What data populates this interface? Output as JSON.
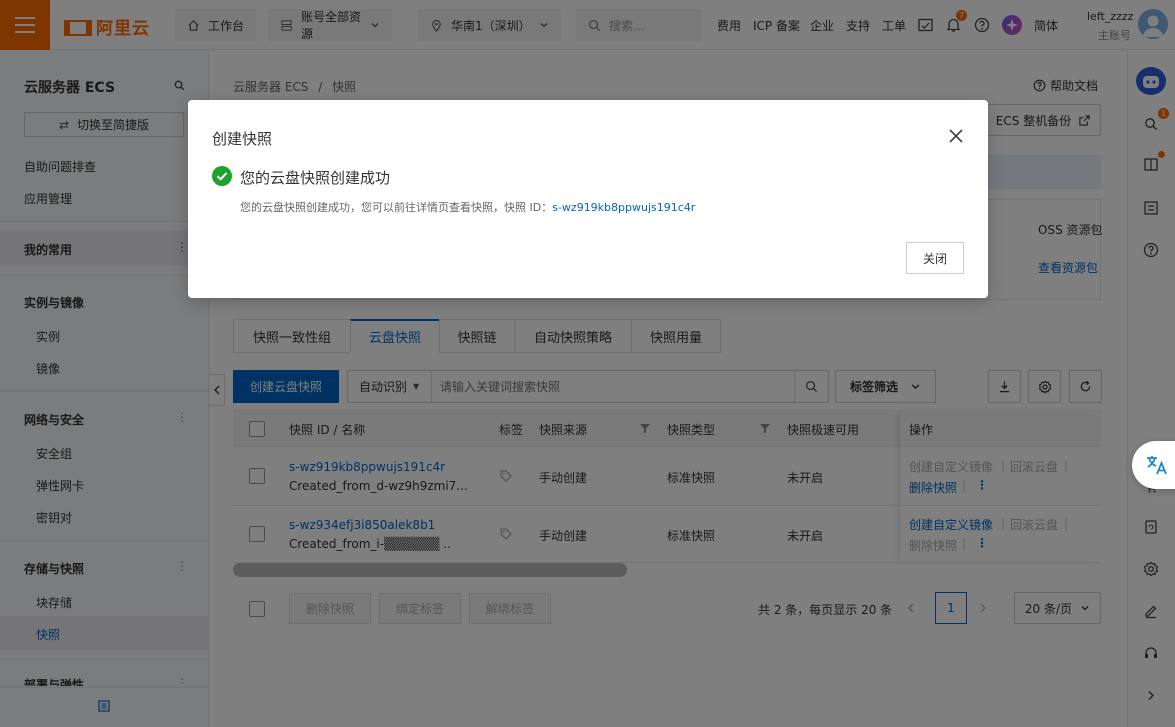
{
  "topbar": {
    "logo": "阿里云",
    "workbench": "工作台",
    "resources": "账号全部资源",
    "region": "华南1（深圳）",
    "search_placeholder": "搜索...",
    "nav": [
      "费用",
      "ICP 备案",
      "企业",
      "支持",
      "工单"
    ],
    "notification_count": "7",
    "language": "简体",
    "username": "left_zzzz",
    "account_type": "主账号"
  },
  "sidebar": {
    "title": "云服务器 ECS",
    "switch_label": "切换至简捷版",
    "items": [
      "自助问题排查",
      "应用管理"
    ],
    "favorites": "我的常用",
    "groups": [
      {
        "title": "实例与镜像",
        "items": [
          "实例",
          "镜像"
        ]
      },
      {
        "title": "网络与安全",
        "items": [
          "安全组",
          "弹性网卡",
          "密钥对"
        ]
      },
      {
        "title": "存储与快照",
        "items": [
          "块存储",
          "快照"
        ]
      },
      {
        "title": "部署与弹性"
      }
    ]
  },
  "main": {
    "breadcrumb_root": "云服务器 ECS",
    "breadcrumb_sep": "/",
    "breadcrumb_current": "快照",
    "help_doc": "帮助文档",
    "ecs_backup": "ECS 整机备份",
    "oss_package": "OSS 资源包",
    "view_package": "查看资源包",
    "tabs": [
      "快照一致性组",
      "云盘快照",
      "快照链",
      "自动快照策略",
      "快照用量"
    ],
    "create_button": "创建云盘快照",
    "filter_select": "自动识别",
    "search_placeholder": "请输入关键词搜索快照",
    "tag_filter": "标签筛选",
    "columns": [
      "快照 ID / 名称",
      "标签",
      "快照来源",
      "快照类型",
      "快照极速可用",
      "操作"
    ],
    "rows": [
      {
        "id": "s-wz919kb8ppwujs191c4r",
        "name": "Created_from_d-wz9h9zmi7...",
        "source": "手动创建",
        "type": "标准快照",
        "fast": "未开启",
        "op1": "创建自定义镜像",
        "op2": "回滚云盘",
        "op3": "删除快照"
      },
      {
        "id": "s-wz934efj3i850alek8b1",
        "name": "Created_from_i-▒▒▒▒▒▒ ..",
        "source": "手动创建",
        "type": "标准快照",
        "fast": "未开启",
        "op1": "创建自定义镜像",
        "op2": "回滚云盘",
        "op3": "删除快照"
      }
    ],
    "bulk": [
      "删除快照",
      "绑定标签",
      "解绑标签"
    ],
    "pagination_info": "共 2 条，每页显示 20 条",
    "current_page": "1",
    "page_size": "20 条/页"
  },
  "modal": {
    "title": "创建快照",
    "success_title": "您的云盘快照创建成功",
    "message": "您的云盘快照创建成功，您可以前往详情页查看快照，快照 ID：",
    "snapshot_id": "s-wz919kb8ppwujs191c4r",
    "close_button": "关闭"
  },
  "colors": {
    "brand": "#ff6a00",
    "primary": "#0064c8",
    "success": "#1fa12f"
  }
}
